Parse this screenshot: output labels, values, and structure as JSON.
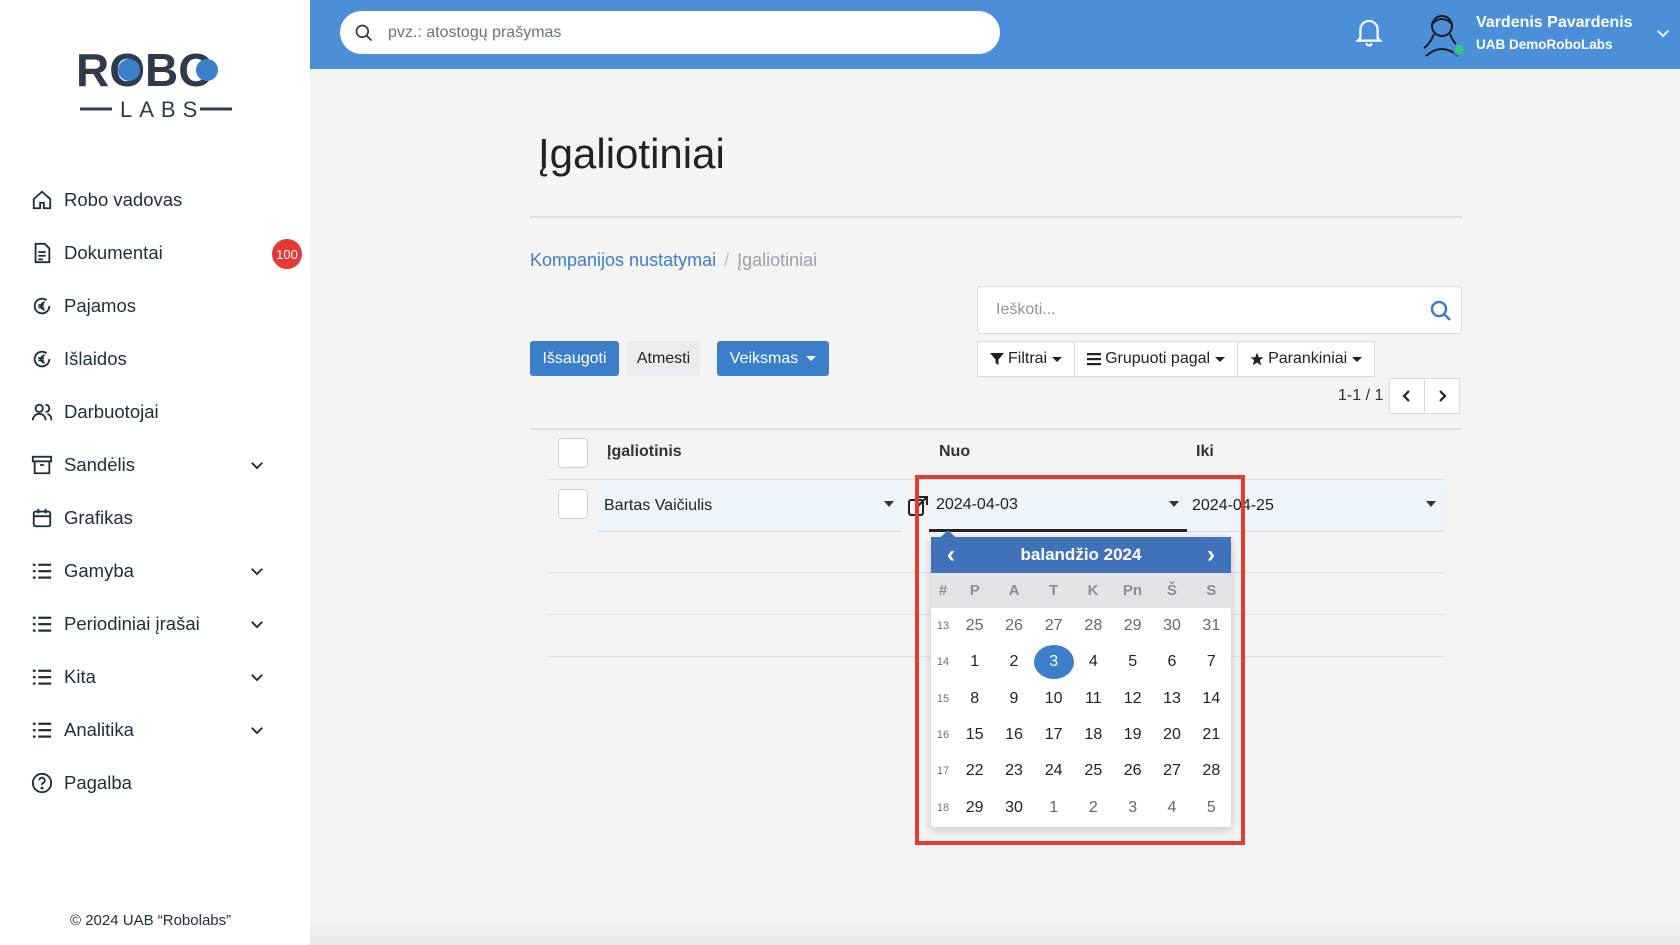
{
  "sidebar": {
    "logo_text_top": "ROBO",
    "logo_text_bottom": "LABS",
    "items": [
      {
        "label": "Robo vadovas",
        "icon": "home-icon"
      },
      {
        "label": "Dokumentai",
        "icon": "document-icon",
        "badge": "100"
      },
      {
        "label": "Pajamos",
        "icon": "euro-in-icon"
      },
      {
        "label": "Išlaidos",
        "icon": "euro-out-icon"
      },
      {
        "label": "Darbuotojai",
        "icon": "users-icon"
      },
      {
        "label": "Sandėlis",
        "icon": "archive-icon",
        "expandable": true
      },
      {
        "label": "Grafikas",
        "icon": "calendar-icon"
      },
      {
        "label": "Gamyba",
        "icon": "list-icon",
        "expandable": true
      },
      {
        "label": "Periodiniai įrašai",
        "icon": "list-icon",
        "expandable": true
      },
      {
        "label": "Kita",
        "icon": "list-icon",
        "expandable": true
      },
      {
        "label": "Analitika",
        "icon": "list-icon",
        "expandable": true
      },
      {
        "label": "Pagalba",
        "icon": "help-icon"
      }
    ],
    "copyright": "© 2024 UAB “Robolabs”"
  },
  "topbar": {
    "search_placeholder": "pvz.: atostogų prašymas",
    "user_name": "Vardenis Pavardenis",
    "user_company": "UAB DemoRoboLabs",
    "accent": "#4a8fd8"
  },
  "page": {
    "title": "Įgaliotiniai",
    "breadcrumb": {
      "parent": "Kompanijos nustatymai",
      "separator": "/",
      "current": "Įgaliotiniai"
    },
    "search_placeholder": "Ieškoti...",
    "buttons": {
      "save": "Išsaugoti",
      "discard": "Atmesti",
      "action": "Veiksmas"
    },
    "filters": {
      "filters": "Filtrai",
      "group_by": "Grupuoti pagal",
      "favorites": "Parankiniai"
    },
    "pager": "1-1 / 1"
  },
  "table": {
    "columns": [
      "Įgaliotinis",
      "Nuo",
      "Iki"
    ],
    "rows": [
      {
        "representative": "Bartas Vaičiulis",
        "from": "2024-04-03",
        "to": "2024-04-25"
      }
    ]
  },
  "datepicker": {
    "month_label": "balandžio 2024",
    "prev": "‹",
    "next": "›",
    "weekdays": [
      "#",
      "P",
      "A",
      "T",
      "K",
      "Pn",
      "Š",
      "S"
    ],
    "selected_day": "3",
    "weeks": [
      {
        "wk": "13",
        "days": [
          "25",
          "26",
          "27",
          "28",
          "29",
          "30",
          "31"
        ],
        "muted": [
          true,
          true,
          true,
          true,
          true,
          true,
          true
        ]
      },
      {
        "wk": "14",
        "days": [
          "1",
          "2",
          "3",
          "4",
          "5",
          "6",
          "7"
        ],
        "muted": [
          false,
          false,
          false,
          false,
          false,
          false,
          false
        ]
      },
      {
        "wk": "15",
        "days": [
          "8",
          "9",
          "10",
          "11",
          "12",
          "13",
          "14"
        ],
        "muted": [
          false,
          false,
          false,
          false,
          false,
          false,
          false
        ]
      },
      {
        "wk": "16",
        "days": [
          "15",
          "16",
          "17",
          "18",
          "19",
          "20",
          "21"
        ],
        "muted": [
          false,
          false,
          false,
          false,
          false,
          false,
          false
        ]
      },
      {
        "wk": "17",
        "days": [
          "22",
          "23",
          "24",
          "25",
          "26",
          "27",
          "28"
        ],
        "muted": [
          false,
          false,
          false,
          false,
          false,
          false,
          false
        ]
      },
      {
        "wk": "18",
        "days": [
          "29",
          "30",
          "1",
          "2",
          "3",
          "4",
          "5"
        ],
        "muted": [
          false,
          false,
          true,
          true,
          true,
          true,
          true
        ]
      }
    ],
    "highlight_color": "#e53b2c"
  }
}
